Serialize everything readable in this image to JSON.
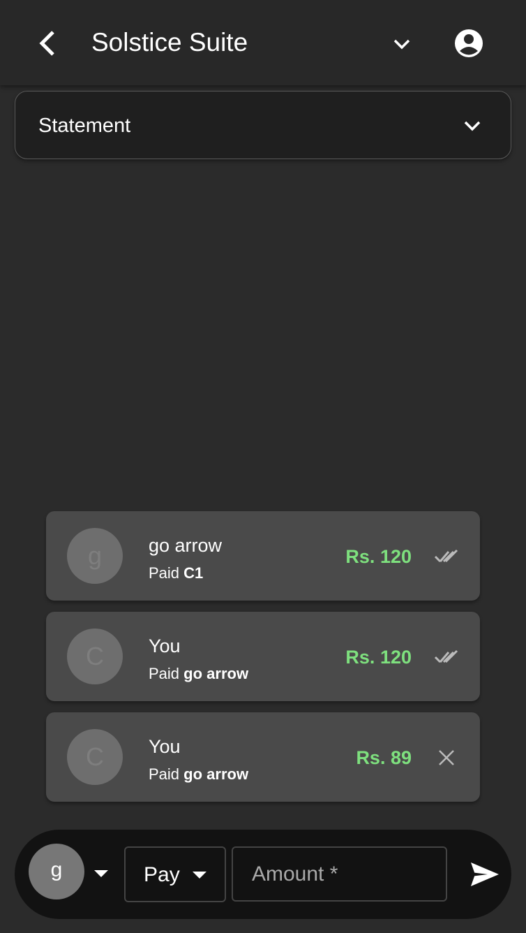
{
  "header": {
    "title": "Solstice Suite"
  },
  "view_select": {
    "value": "Statement"
  },
  "transactions": [
    {
      "avatar": "g",
      "name": "go arrow",
      "prefix": "Paid",
      "target": "C1",
      "amount": "Rs. 120",
      "status": "double-check-icon"
    },
    {
      "avatar": "C",
      "name": "You",
      "prefix": "Paid",
      "target": "go arrow",
      "amount": "Rs. 120",
      "status": "double-check-icon"
    },
    {
      "avatar": "C",
      "name": "You",
      "prefix": "Paid",
      "target": "go arrow",
      "amount": "Rs. 89",
      "status": "close-icon"
    }
  ],
  "composer": {
    "avatar": "g",
    "type": "Pay",
    "amount_placeholder": "Amount *",
    "amount_value": ""
  },
  "colors": {
    "amount": "#7ee07e",
    "background": "#2b2b2b"
  }
}
